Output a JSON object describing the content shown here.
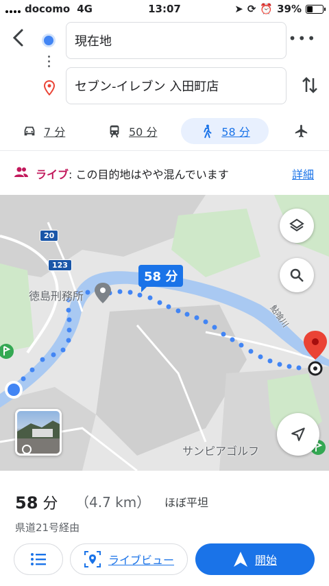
{
  "status_bar": {
    "carrier": "docomo",
    "network": "4G",
    "time": "13:07",
    "battery": "39%",
    "battery_level": 0.39
  },
  "search": {
    "origin": "現在地",
    "destination": "セブン-イレブン 入田町店"
  },
  "modes": [
    {
      "id": "car",
      "icon": "car-icon",
      "label": "7 分"
    },
    {
      "id": "train",
      "icon": "train-icon",
      "label": "50 分"
    },
    {
      "id": "walk",
      "icon": "walk-icon",
      "label": "58 分"
    },
    {
      "id": "flight",
      "icon": "flight-icon",
      "label": ""
    }
  ],
  "live": {
    "label": "ライブ",
    "text": ": この目的地はやや混んでいます",
    "details": "詳細"
  },
  "map": {
    "duration_label": "58 分",
    "places": [
      "徳島刑務所",
      "鮎喰川",
      "サンピアゴルフ"
    ],
    "road_badges": [
      "20",
      "123"
    ],
    "route_color": "#4285f4"
  },
  "summary": {
    "time_value": "58",
    "time_unit": "分",
    "distance": "（4.7 km）",
    "terrain": "ほぼ平坦",
    "via": "県道21号経由"
  },
  "actions": {
    "live_view": "ライブビュー",
    "start": "開始"
  },
  "colors": {
    "accent": "#1a73e8",
    "live": "#c2185b",
    "destination": "#ea4335"
  }
}
